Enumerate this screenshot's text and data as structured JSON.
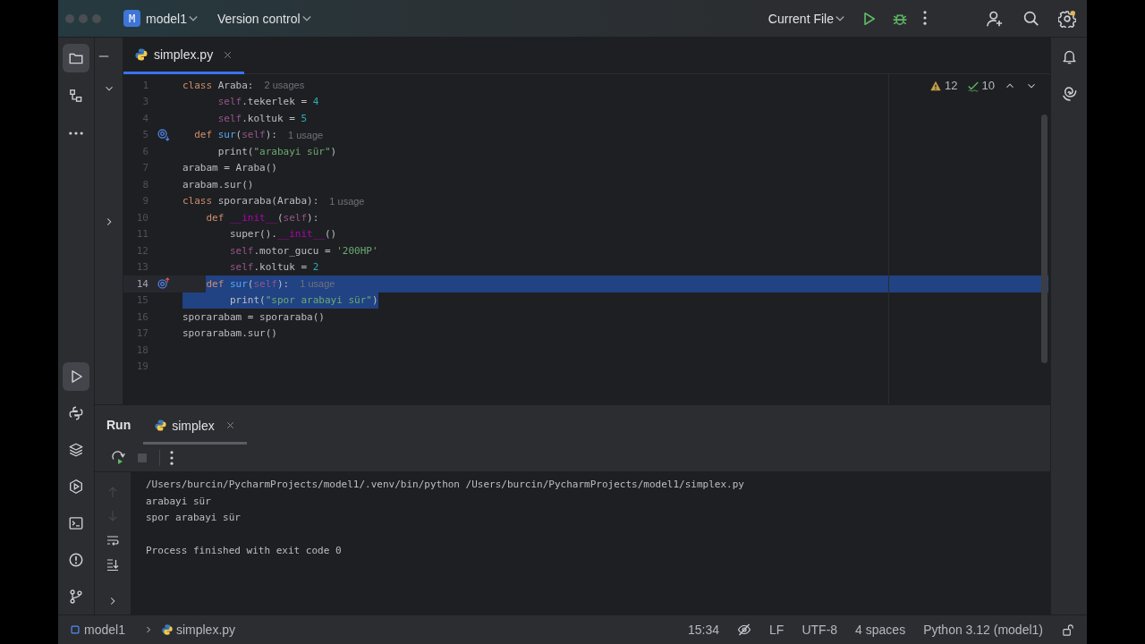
{
  "title_bar": {
    "project_badge": "M",
    "project": "model1",
    "vcs": "Version control",
    "run_config": "Current File"
  },
  "left_toolbar": {
    "top": [
      {
        "kind": "project",
        "selected": true
      },
      {
        "kind": "structure",
        "selected": false
      },
      {
        "kind": "more",
        "selected": false
      }
    ],
    "bottom": [
      {
        "kind": "run",
        "selected": true
      },
      {
        "kind": "python-console",
        "selected": false
      },
      {
        "kind": "layers",
        "selected": false
      },
      {
        "kind": "services",
        "selected": false
      },
      {
        "kind": "terminal",
        "selected": false
      },
      {
        "kind": "problems",
        "selected": false
      },
      {
        "kind": "git",
        "selected": false
      }
    ]
  },
  "editor": {
    "tabs": [
      {
        "label": "simplex.py",
        "selected": true
      }
    ],
    "inspections": {
      "warnings": "12",
      "typos": "10"
    },
    "lines": [
      {
        "number": "1",
        "tokens": [
          {
            "kind": "keyword",
            "text": "class"
          },
          {
            "kind": "plain",
            "text": " Araba:"
          }
        ],
        "hint": "2 usages"
      },
      {
        "number": "3",
        "tokens": [
          {
            "kind": "self",
            "text": "      self"
          },
          {
            "kind": "plain",
            "text": ".tekerlek = "
          },
          {
            "kind": "number",
            "text": "4"
          }
        ]
      },
      {
        "number": "4",
        "tokens": [
          {
            "kind": "self",
            "text": "      self"
          },
          {
            "kind": "plain",
            "text": ".koltuk = "
          },
          {
            "kind": "number",
            "text": "5"
          }
        ]
      },
      {
        "number": "5",
        "gutter_icon": {
          "kind": "overridden"
        },
        "tokens": [
          {
            "kind": "keyword",
            "text": "  def"
          },
          {
            "kind": "function",
            "text": " sur"
          },
          {
            "kind": "plain",
            "text": "("
          },
          {
            "kind": "self",
            "text": "self"
          },
          {
            "kind": "plain",
            "text": "):"
          }
        ],
        "hint": "1 usage"
      },
      {
        "number": "6",
        "tokens": [
          {
            "kind": "plain",
            "text": "      print("
          },
          {
            "kind": "string",
            "text": "\"arabayi sür\""
          },
          {
            "kind": "plain",
            "text": ")"
          }
        ]
      },
      {
        "number": "7",
        "tokens": [
          {
            "kind": "plain",
            "text": "arabam = Araba()"
          }
        ]
      },
      {
        "number": "8",
        "tokens": [
          {
            "kind": "plain",
            "text": "arabam.sur()"
          }
        ]
      },
      {
        "number": "9",
        "tokens": [
          {
            "kind": "keyword",
            "text": "class"
          },
          {
            "kind": "plain",
            "text": " sporaraba(Araba):"
          }
        ],
        "hint": "1 usage"
      },
      {
        "number": "10",
        "tokens": [
          {
            "kind": "keyword",
            "text": "    def"
          },
          {
            "kind": "magic",
            "text": " __init__"
          },
          {
            "kind": "plain",
            "text": "("
          },
          {
            "kind": "self",
            "text": "self"
          },
          {
            "kind": "plain",
            "text": "):"
          }
        ]
      },
      {
        "number": "11",
        "tokens": [
          {
            "kind": "plain",
            "text": "        super()."
          },
          {
            "kind": "magic",
            "text": "__init__"
          },
          {
            "kind": "plain",
            "text": "()"
          }
        ]
      },
      {
        "number": "12",
        "tokens": [
          {
            "kind": "self",
            "text": "        self"
          },
          {
            "kind": "plain",
            "text": ".motor_gucu = "
          },
          {
            "kind": "string",
            "text": "'200HP'"
          }
        ]
      },
      {
        "number": "13",
        "tokens": [
          {
            "kind": "self",
            "text": "        self"
          },
          {
            "kind": "plain",
            "text": ".koltuk = "
          },
          {
            "kind": "number",
            "text": "2"
          }
        ]
      },
      {
        "number": "14",
        "current": true,
        "gutter_icon": {
          "kind": "overriding"
        },
        "selection": {
          "kind": "rest"
        },
        "tokens": [
          {
            "kind": "keyword",
            "text": "    def"
          },
          {
            "kind": "function",
            "text": " sur"
          },
          {
            "kind": "plain",
            "text": "("
          },
          {
            "kind": "self",
            "text": "self"
          },
          {
            "kind": "plain",
            "text": "):"
          }
        ],
        "hint": "1 usage"
      },
      {
        "number": "15",
        "selection": {
          "kind": "whole"
        },
        "tokens": [
          {
            "kind": "plain",
            "text": "        print("
          },
          {
            "kind": "string",
            "text": "\"spor arabayi sür\""
          },
          {
            "kind": "plain",
            "text": ")"
          }
        ]
      },
      {
        "number": "16",
        "tokens": [
          {
            "kind": "plain",
            "text": "sporarabam = sporaraba()"
          }
        ]
      },
      {
        "number": "17",
        "tokens": [
          {
            "kind": "plain",
            "text": "sporarabam.sur()"
          }
        ]
      },
      {
        "number": "18"
      },
      {
        "number": "19"
      }
    ]
  },
  "run_panel": {
    "title": "Run",
    "tabs": [
      {
        "label": "simplex",
        "selected": true
      }
    ],
    "toolbar": [
      {
        "kind": "rerun",
        "disabled": false
      },
      {
        "kind": "stop",
        "disabled": true
      },
      {
        "kind": "more",
        "disabled": false
      }
    ],
    "side": [
      {
        "kind": "up",
        "disabled": true
      },
      {
        "kind": "down",
        "disabled": true
      },
      {
        "kind": "wrap",
        "disabled": false
      },
      {
        "kind": "scroll-end",
        "disabled": false
      }
    ],
    "output": [
      {
        "kind": "command",
        "text": "/Users/burcin/PycharmProjects/model1/.venv/bin/python /Users/burcin/PycharmProjects/model1/simplex.py"
      },
      {
        "kind": "output",
        "text": "arabayi sür"
      },
      {
        "kind": "output",
        "text": "spor arabayi sür"
      },
      {
        "kind": "exit",
        "text": "Process finished with exit code 0"
      }
    ]
  },
  "status_bar": {
    "breadcrumbs": [
      {
        "kind": "module",
        "label": "model1"
      },
      {
        "kind": "file",
        "label": "simplex.py"
      }
    ],
    "position": "15:34",
    "line_separator": "LF",
    "encoding": "UTF-8",
    "indent": "4 spaces",
    "interpreter": "Python 3.12 (model1)"
  }
}
